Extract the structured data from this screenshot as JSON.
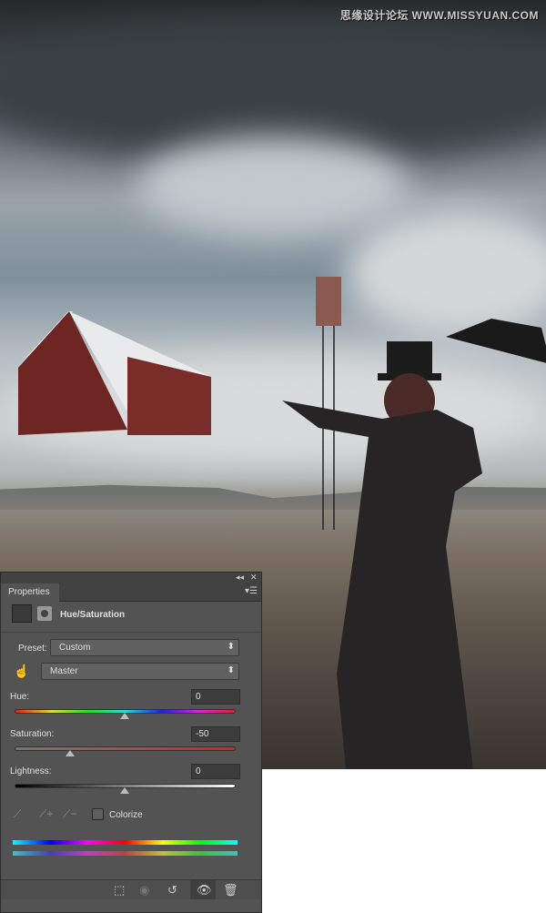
{
  "watermark": "思缘设计论坛  WWW.MISSYUAN.COM",
  "panel": {
    "tab": "Properties",
    "title": "Hue/Saturation",
    "preset_label": "Preset:",
    "preset_value": "Custom",
    "channel_value": "Master",
    "hue": {
      "label": "Hue:",
      "value": "0",
      "fraction": 0.5
    },
    "saturation": {
      "label": "Saturation:",
      "value": "-50",
      "fraction": 0.25
    },
    "lightness": {
      "label": "Lightness:",
      "value": "0",
      "fraction": 0.5
    },
    "colorize_label": "Colorize",
    "colorize_checked": false
  }
}
